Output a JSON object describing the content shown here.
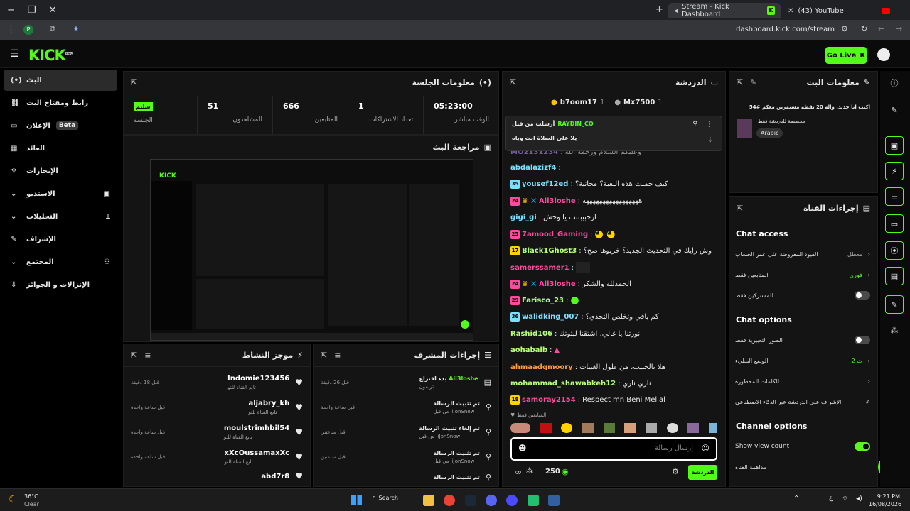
{
  "browser": {
    "tabs": [
      {
        "label": "Stream - Kick Dashboard"
      },
      {
        "label": "(43) YouTube"
      }
    ],
    "url": "dashboard.kick.com/stream",
    "window_controls": [
      "−",
      "❐",
      "✕"
    ]
  },
  "header": {
    "logo": "KICK",
    "logo_sup": "BETA",
    "go_live": "Go Live"
  },
  "sidebar": {
    "items": [
      {
        "label": "البث",
        "icon": "broadcast-icon",
        "glyph": "(•)"
      },
      {
        "label": "رابط ومفتاح البث",
        "icon": "link-icon",
        "glyph": "⛓"
      },
      {
        "label": "الإعلان",
        "icon": "ad-icon",
        "glyph": "▭",
        "badge": "Beta"
      },
      {
        "label": "العائد",
        "icon": "revenue-icon",
        "glyph": "▦"
      },
      {
        "label": "الإنجازات",
        "icon": "trophy-icon",
        "glyph": "♆"
      },
      {
        "label": "الاستديو",
        "icon": "studio-icon",
        "glyph": "▣",
        "expand": "⌄"
      },
      {
        "label": "التحليلات",
        "icon": "analytics-icon",
        "glyph": "⫫",
        "expand": "⌄"
      },
      {
        "label": "الإشراف",
        "icon": "moderation-icon",
        "glyph": "✎"
      },
      {
        "label": "المجتمع",
        "icon": "community-icon",
        "glyph": "⚇",
        "expand": "⌄"
      },
      {
        "label": "الإنزالات و الجوائز",
        "icon": "drops-icon",
        "glyph": "⇩"
      }
    ]
  },
  "session": {
    "title": "معلومات الجلسة",
    "stats": [
      {
        "value": "سليم",
        "label": "الجلسة"
      },
      {
        "value": "51",
        "label": "المشاهدون"
      },
      {
        "value": "666",
        "label": "المتابعين"
      },
      {
        "value": "1",
        "label": "تعداد الاشتراكات"
      },
      {
        "value": "05:23:00",
        "label": "الوقت مباشر"
      }
    ]
  },
  "preview": {
    "title": "مراجعة البث"
  },
  "activity": {
    "title": "موجز النشاط",
    "items": [
      {
        "name": "Indomie123456",
        "sub": "تابع القناة للتو",
        "time": "قبل 18 دقيقة"
      },
      {
        "name": "aljabry_kh",
        "sub": "تابع القناة للتو",
        "time": "قبل ساعة واحدة"
      },
      {
        "name": "moulstrimhbil54",
        "sub": "تابع القناة للتو",
        "time": "قبل ساعة واحدة"
      },
      {
        "name": "xXcOussamaxXc",
        "sub": "تابع القناة للتو",
        "time": "قبل ساعة واحدة"
      },
      {
        "name": "abd7r8",
        "sub": "",
        "time": ""
      }
    ]
  },
  "modactions": {
    "title": "إجراءات المشرف",
    "items": [
      {
        "action": "بدء اقتراع",
        "user": "Ali3loshe",
        "sub": "تريمون",
        "time": "قبل 26 دقيقة",
        "icon": "poll-icon",
        "glyph": "▤"
      },
      {
        "action": "تم تثبيت الرسالة",
        "user": "",
        "sub": "من قبل IiJonSnow",
        "time": "قبل ساعة واحدة",
        "icon": "pin-icon",
        "glyph": "⚲"
      },
      {
        "action": "تم إلغاء تثبيت الرسالة",
        "user": "",
        "sub": "من قبل IiJonSnow",
        "time": "قبل ساعتين",
        "icon": "unpin-icon",
        "glyph": "⚲"
      },
      {
        "action": "تم تثبيت الرسالة",
        "user": "",
        "sub": "من قبل IiJonSnow",
        "time": "قبل ساعتين",
        "icon": "pin-icon",
        "glyph": "⚲"
      },
      {
        "action": "تم تثبيت الرسالة",
        "user": "",
        "sub": "",
        "time": "",
        "icon": "pin-icon",
        "glyph": "⚲"
      }
    ]
  },
  "chat": {
    "title": "الدردشة",
    "top_gifters": [
      {
        "name": "b7oom17",
        "count": "1"
      },
      {
        "name": "Mx7500",
        "count": "1"
      }
    ],
    "pinned": {
      "by": "أرسلت من قبل",
      "user": "RAYDIN_CO",
      "text": "يلا على الصلاة انت وياه"
    },
    "messages": [
      {
        "user": "MO2131234",
        "color": "#b48cff",
        "text": "وعليكم السلام ورحمة الله",
        "badges": []
      },
      {
        "user": "abdalazizf4",
        "color": "#7ae1ff",
        "text": "",
        "badges": []
      },
      {
        "user": "yousef12ed",
        "color": "#7ae1ff",
        "text": "كيف حملت هذه اللعبة؟ مجانية؟",
        "badges": [
          "35"
        ]
      },
      {
        "user": "Ali3loshe",
        "color": "#ff4aa0",
        "text": "هههههههههههههههههه",
        "badges": [
          "24"
        ]
      },
      {
        "user": "gigi_gi",
        "color": "#7ae1ff",
        "text": "ارحبببببب يا وحش",
        "badges": []
      },
      {
        "user": "7amood_Gaming",
        "color": "#ff4aa0",
        "text": "",
        "badges": [
          "25"
        ]
      },
      {
        "user": "Black1Ghost3",
        "color": "#b6ff7a",
        "text": "وش رايك في التحديث الجديد؟ خربوها صح؟",
        "badges": [
          "17"
        ]
      },
      {
        "user": "samerssamer1",
        "color": "#ff4aa0",
        "text": "",
        "badges": []
      },
      {
        "user": "Ali3loshe",
        "color": "#ff4aa0",
        "text": "الحمدلله والشكر",
        "badges": [
          "24"
        ]
      },
      {
        "user": "Farisco_23",
        "color": "#b6ff7a",
        "text": "",
        "badges": [
          "29"
        ]
      },
      {
        "user": "walidking_007",
        "color": "#7ae1ff",
        "text": "كم باقي وتخلص التحدي؟",
        "badges": [
          "36"
        ]
      },
      {
        "user": "Rashid106",
        "color": "#b6ff7a",
        "text": "نورتنا يا غالي، اشتقنا لبثوتك",
        "badges": []
      },
      {
        "user": "aohabaib",
        "color": "#b6ff7a",
        "text": "",
        "badges": []
      },
      {
        "user": "ahmaadqmoory",
        "color": "#ff9b3a",
        "text": "هلا بالحبيب، من طول الغيبات",
        "badges": []
      },
      {
        "user": "mohammad_shawabkeh12",
        "color": "#b6ff7a",
        "text": "ناري ناري",
        "badges": []
      },
      {
        "user": "samoray2154",
        "color": "#ff4aa0",
        "text": "Respect mn Beni Mellal",
        "badges": [
          "18"
        ]
      }
    ],
    "followers_only": "المتابعين فقط",
    "input_placeholder": "إرسال رسالة",
    "send_button": "الدردشة",
    "points": "250"
  },
  "stream_info": {
    "title": "معلومات البث",
    "stream_title": "اكتب انا جديد. وآله 20 نقطة مستمرين معكم #54",
    "category": "مخصصة للدردشة فقط",
    "language": "Arabic"
  },
  "channel_actions": {
    "title": "إجراءات القناة",
    "chat_access_head": "Chat access",
    "chat_access": [
      {
        "label": "القيود المفروضة على عمر الحساب",
        "value": "معطل",
        "control": "chevron"
      },
      {
        "label": "المتابعين فقط",
        "value": "فوري",
        "control": "chevron",
        "value_color": "#53fc18"
      },
      {
        "label": "للمشتركين فقط",
        "value": "",
        "control": "toggle",
        "on": false
      }
    ],
    "chat_options_head": "Chat options",
    "chat_options": [
      {
        "label": "الصور التعبيرية فقط",
        "value": "",
        "control": "toggle",
        "on": false
      },
      {
        "label": "الوضع البطيء",
        "value": "2 ث",
        "control": "chevron",
        "value_color": "#53fc18"
      },
      {
        "label": "الكلمات المحظورة",
        "value": "",
        "control": "chevron"
      },
      {
        "label": "الإشراف على الدردشة عبر الذكاء الاصطناعي",
        "value": "",
        "control": "external"
      }
    ],
    "channel_options_head": "Channel options",
    "channel_options": [
      {
        "label": "Show view count",
        "control": "toggle",
        "on": true
      },
      {
        "label": "مداهمة القناة",
        "control": "none"
      }
    ]
  },
  "taskbar": {
    "weather_temp": "36°C",
    "weather_desc": "Clear",
    "search": "Search",
    "time": "9:21 PM",
    "date": "16/08/2026",
    "lang": "ع"
  }
}
